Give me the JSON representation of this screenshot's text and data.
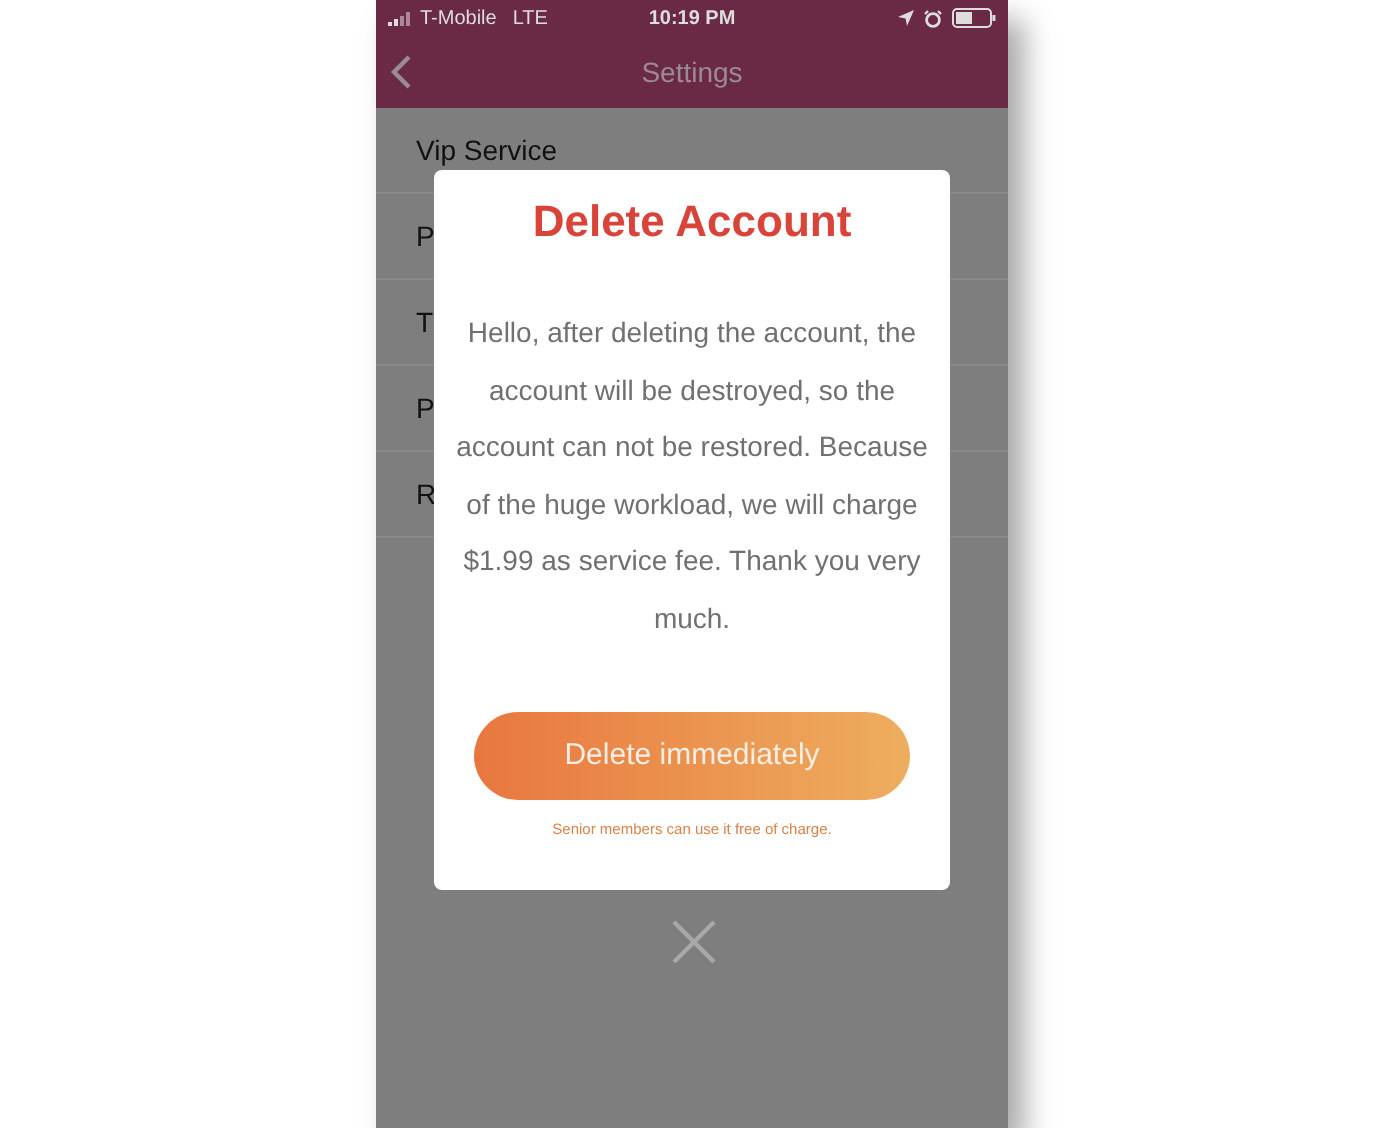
{
  "status_bar": {
    "carrier": "T-Mobile",
    "network": "LTE",
    "time": "10:19 PM"
  },
  "nav": {
    "title": "Settings"
  },
  "settings_items": [
    {
      "label": "Vip Service"
    },
    {
      "label": "P"
    },
    {
      "label": "T"
    },
    {
      "label": "P"
    },
    {
      "label": "R"
    }
  ],
  "dialog": {
    "title": "Delete Account",
    "message": "Hello, after deleting the account, the account will be destroyed, so the account can not be restored. Because of the huge workload, we will charge $1.99 as service fee. Thank you very much.",
    "button": "Delete immediately",
    "note": "Senior members can use it free of charge."
  }
}
